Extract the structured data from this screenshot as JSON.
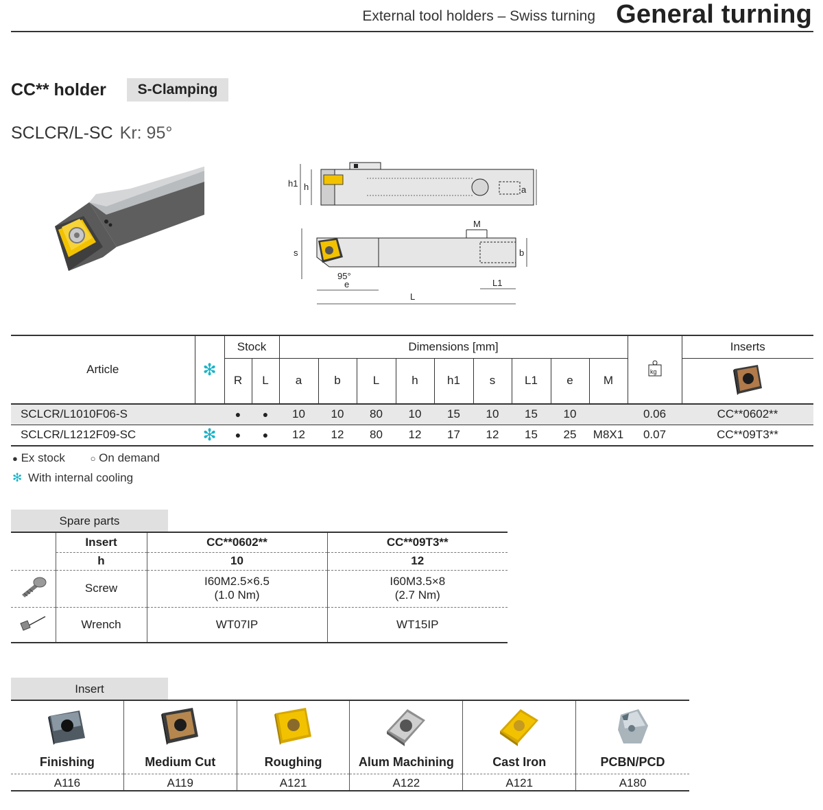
{
  "header": {
    "subtitle": "External tool holders – Swiss turning",
    "title": "General turning"
  },
  "holder": {
    "title": "CC** holder",
    "clamping": "S-Clamping",
    "model": "SCLCR/L-SC",
    "kr": "Kr: 95°"
  },
  "drawing_labels": {
    "h1": "h1",
    "h": "h",
    "a": "a",
    "M": "M",
    "s": "s",
    "b": "b",
    "angle": "95°",
    "e": "e",
    "L1": "L1",
    "L": "L"
  },
  "table": {
    "article_header": "Article",
    "stock_header": "Stock",
    "dimensions_header": "Dimensions [mm]",
    "inserts_header": "Inserts",
    "weight_icon_label": "kg",
    "stock_cols": [
      "R",
      "L"
    ],
    "dim_cols": [
      "a",
      "b",
      "L",
      "h",
      "h1",
      "s",
      "L1",
      "e",
      "M"
    ],
    "rows": [
      {
        "article": "SCLCR/L1010F06-S",
        "cooling": "",
        "stock_r": "●",
        "stock_l": "●",
        "a": "10",
        "b": "10",
        "L": "80",
        "h": "10",
        "h1": "15",
        "s": "10",
        "L1": "15",
        "e": "10",
        "M": "",
        "weight": "0.06",
        "insert": "CC**0602**"
      },
      {
        "article": "SCLCR/L1212F09-SC",
        "cooling": "✻",
        "stock_r": "●",
        "stock_l": "●",
        "a": "12",
        "b": "12",
        "L": "80",
        "h": "12",
        "h1": "17",
        "s": "12",
        "L1": "15",
        "e": "25",
        "M": "M8X1",
        "weight": "0.07",
        "insert": "CC**09T3**"
      }
    ]
  },
  "legend": {
    "ex_stock": "Ex stock",
    "on_demand": "On demand",
    "cooling": "With internal cooling"
  },
  "spare_parts": {
    "tab": "Spare parts",
    "insert_label": "Insert",
    "h_label": "h",
    "screw_label": "Screw",
    "wrench_label": "Wrench",
    "columns": [
      {
        "insert": "CC**0602**",
        "h": "10",
        "screw": "I60M2.5×6.5",
        "torque": "(1.0 Nm)",
        "wrench": "WT07IP"
      },
      {
        "insert": "CC**09T3**",
        "h": "12",
        "screw": "I60M3.5×8",
        "torque": "(2.7 Nm)",
        "wrench": "WT15IP"
      }
    ]
  },
  "insert_grades": {
    "tab": "Insert",
    "items": [
      {
        "name": "Finishing",
        "code": "A116",
        "icon": "finishing-insert-icon"
      },
      {
        "name": "Medium Cut",
        "code": "A119",
        "icon": "medium-cut-insert-icon"
      },
      {
        "name": "Roughing",
        "code": "A121",
        "icon": "roughing-insert-icon"
      },
      {
        "name": "Alum Machining",
        "code": "A122",
        "icon": "alum-insert-icon"
      },
      {
        "name": "Cast Iron",
        "code": "A121",
        "icon": "cast-iron-insert-icon"
      },
      {
        "name": "PCBN/PCD",
        "code": "A180",
        "icon": "pcbn-insert-icon"
      }
    ]
  }
}
